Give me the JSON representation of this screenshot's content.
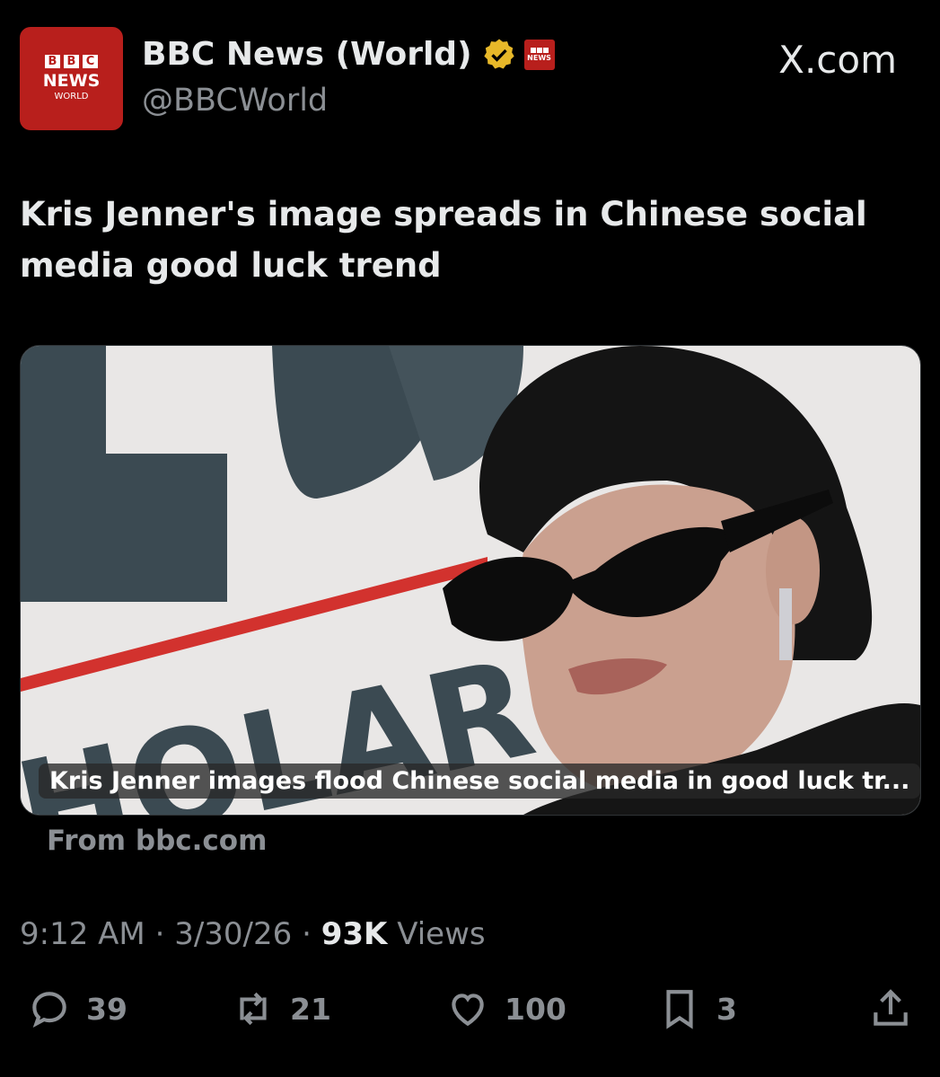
{
  "account": {
    "avatar_top": "BBC",
    "avatar_news": "NEWS",
    "avatar_world": "WORLD",
    "name": "BBC News (World)",
    "handle": "@BBCWorld",
    "affiliate_text": "NEWS",
    "verified_color": "#e7b829"
  },
  "site_label": "X.com",
  "post": {
    "text": "Kris Jenner's image spreads in Chinese social media good luck trend"
  },
  "card": {
    "caption": "Kris Jenner images flood Chinese social media in good luck tr...",
    "from": "From bbc.com"
  },
  "meta": {
    "time": "9:12 AM",
    "date": "3/30/26",
    "views_count": "93K",
    "views_label": "Views"
  },
  "actions": {
    "replies": "39",
    "reposts": "21",
    "likes": "100",
    "bookmarks": "3"
  },
  "colors": {
    "bbc_red": "#b81f1c",
    "background": "#000000",
    "muted": "#8b8f94"
  }
}
